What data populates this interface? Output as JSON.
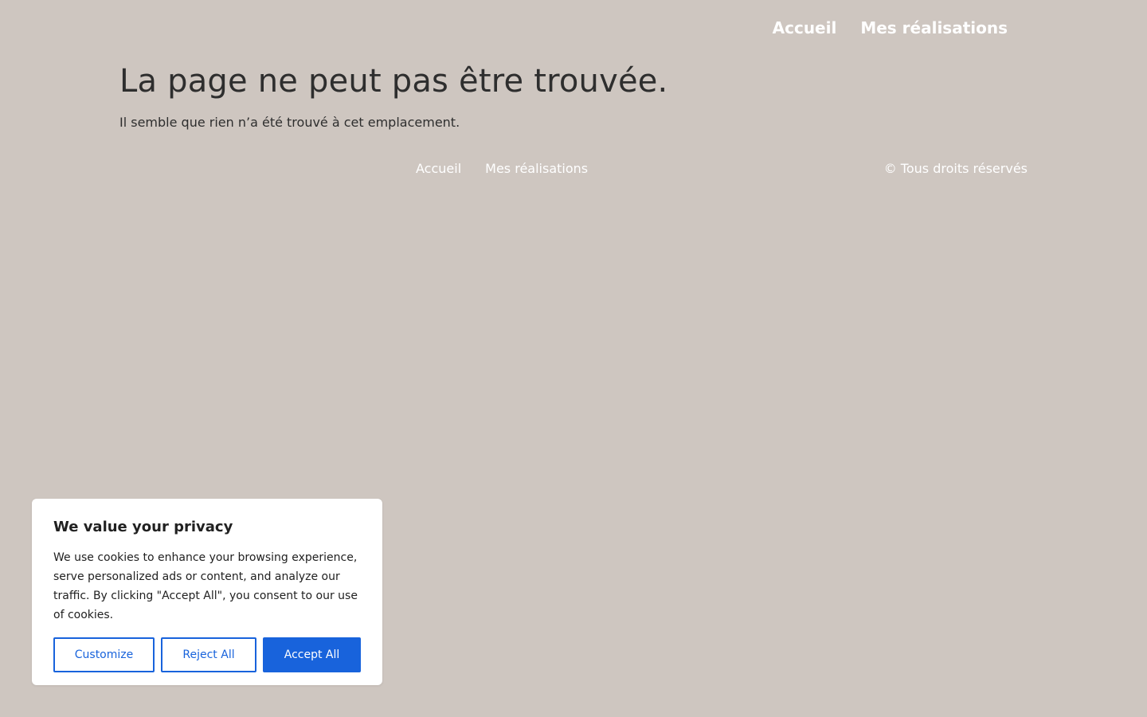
{
  "header": {
    "nav": [
      {
        "label": "Accueil"
      },
      {
        "label": "Mes réalisations"
      }
    ]
  },
  "main": {
    "title": "La page ne peut pas être trouvée.",
    "message": "Il semble que rien n’a été trouvé à cet emplacement."
  },
  "footer": {
    "nav": [
      {
        "label": "Accueil"
      },
      {
        "label": "Mes réalisations"
      }
    ],
    "copyright": "© Tous droits réservés"
  },
  "cookie_banner": {
    "title": "We value your privacy",
    "text": "We use cookies to enhance your browsing experience, serve personalized ads or content, and analyze our traffic. By clicking \"Accept All\", you consent to our use of cookies.",
    "customize_label": "Customize",
    "reject_label": "Reject All",
    "accept_label": "Accept All"
  },
  "colors": {
    "background": "#cec6c0",
    "accent": "#1863dc",
    "text": "#2e2e2e"
  }
}
